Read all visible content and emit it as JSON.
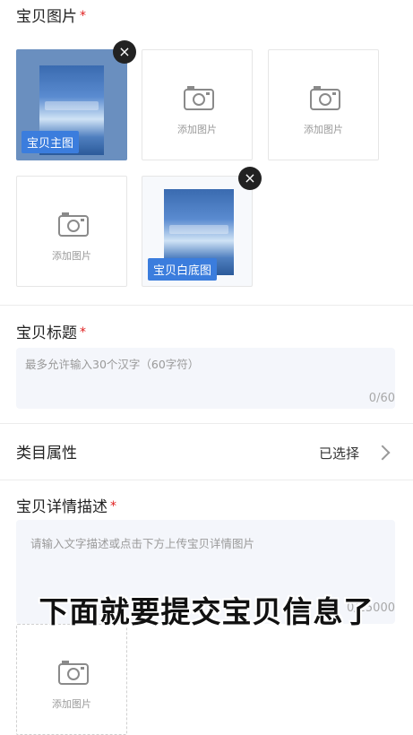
{
  "photos": {
    "title": "宝贝图片",
    "required_mark": "*",
    "add_label": "添加图片",
    "main_badge": "宝贝主图",
    "white_badge": "宝贝白底图",
    "remove": "×"
  },
  "title_field": {
    "label": "宝贝标题",
    "required_mark": "*",
    "placeholder": "最多允许输入30个汉字（60字符）",
    "counter": "0/60"
  },
  "category": {
    "label": "类目属性",
    "value": "已选择"
  },
  "detail": {
    "label": "宝贝详情描述",
    "required_mark": "*",
    "placeholder": "请输入文字描述或点击下方上传宝贝详情图片",
    "counter": "0/25000",
    "add_label": "添加图片"
  },
  "overlay": {
    "caption": "下面就要提交宝贝信息了"
  }
}
